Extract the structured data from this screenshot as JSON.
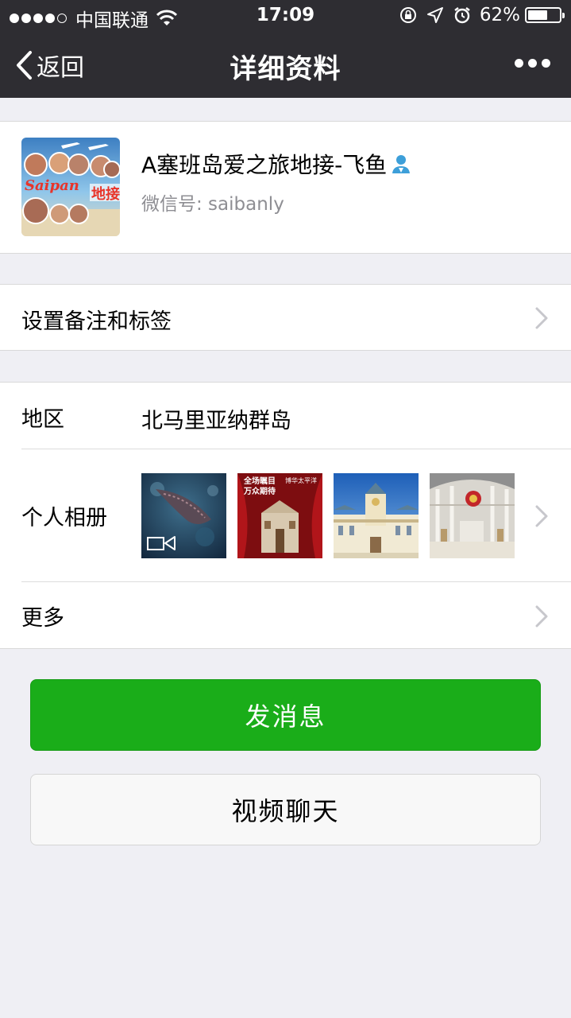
{
  "status_bar": {
    "carrier": "中国联通",
    "time": "17:09",
    "battery": "62%",
    "battery_level": 0.62
  },
  "nav": {
    "back_label": "返回",
    "title": "详细资料"
  },
  "profile": {
    "name": "A塞班岛爱之旅地接-飞鱼",
    "wechat_id": "微信号:  saibanly"
  },
  "rows": {
    "remark_label": "设置备注和标签",
    "region_label": "地区",
    "region_value": "北马里亚纳群岛",
    "album_label": "个人相册",
    "more_label": "更多"
  },
  "album_thumbs": [
    {
      "kind": "video",
      "name": "video-thumbnail-underwater"
    },
    {
      "kind": "image",
      "name": "theater-poster",
      "text_line1": "全场瞩目",
      "text_line2": "万众期待",
      "text_line3": "博华太平洋"
    },
    {
      "kind": "image",
      "name": "palace-photo"
    },
    {
      "kind": "image",
      "name": "interior-photo"
    }
  ],
  "buttons": {
    "send_message": "发消息",
    "video_chat": "视频聊天"
  },
  "colors": {
    "nav_bg": "#2e2d32",
    "primary_green": "#1aad19",
    "page_bg": "#efeff4",
    "secondary_text": "#8e8e93",
    "verified_blue": "#3d9fd9"
  }
}
